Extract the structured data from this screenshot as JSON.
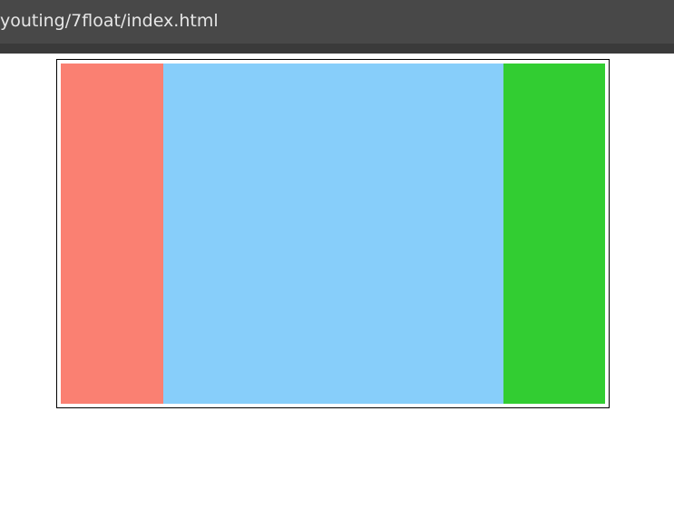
{
  "window": {
    "title": "youting/7float/index.html"
  },
  "layout": {
    "columns": [
      {
        "name": "left",
        "color": "#fa8072"
      },
      {
        "name": "center",
        "color": "#87cefa"
      },
      {
        "name": "right",
        "color": "#32cd32"
      }
    ]
  }
}
